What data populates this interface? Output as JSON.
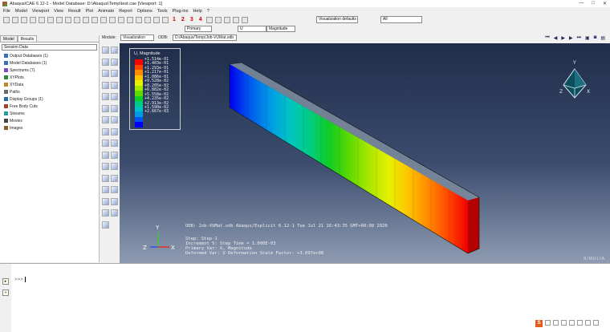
{
  "window": {
    "title": "Abaqus/CAE 6.12-1 - Model Database: D:\\Abaqus\\Temp\\test.cae [Viewport: 1]",
    "controls": [
      "—",
      "□",
      "✕"
    ]
  },
  "menu": [
    "File",
    "Model",
    "Viewport",
    "View",
    "Result",
    "Plot",
    "Animate",
    "Report",
    "Options",
    "Tools",
    "Plug-ins",
    "Help",
    "?"
  ],
  "toolbar": {
    "numbers": [
      "1",
      "2",
      "3",
      "4"
    ],
    "visualization_select": "Visualization defaults",
    "search_value": "All"
  },
  "toolbar2": {
    "step_select": "Primary",
    "u_select": "U",
    "magnitude_select": "Magnitude"
  },
  "module_row": {
    "module_label": "Module:",
    "module_value": "Visualization",
    "odb_label": "ODB:",
    "odb_value": "D:/Abaqus/Temp/Job-VUMat.odb"
  },
  "left_panel": {
    "tabs": [
      "Model",
      "Results"
    ],
    "active_tab": "Results",
    "session_box": "Session Data",
    "tree": [
      {
        "label": "Output Databases (1)",
        "icon": "database-icon"
      },
      {
        "label": "Model Databases (1)",
        "icon": "database-icon"
      },
      {
        "label": "Spectrums (7)",
        "icon": "spectrum-icon"
      },
      {
        "label": "XYPlots",
        "icon": "xyplot-icon"
      },
      {
        "label": "XYData",
        "icon": "xydata-icon"
      },
      {
        "label": "Paths",
        "icon": "path-icon"
      },
      {
        "label": "Display Groups (1)",
        "icon": "display-group-icon"
      },
      {
        "label": "Free Body Cuts",
        "icon": "freebody-icon"
      },
      {
        "label": "Streams",
        "icon": "stream-icon"
      },
      {
        "label": "Movies",
        "icon": "movie-icon"
      },
      {
        "label": "Images",
        "icon": "image-icon"
      }
    ]
  },
  "legend": {
    "title": "U, Magnitude",
    "values": [
      "+1.514e-01",
      "+1.403e-01",
      "+1.293e-01",
      "+1.217e-01",
      "+1.086e-01",
      "+9.528e-02",
      "+8.205e-02",
      "+6.882e-02",
      "+5.558e-02",
      "+4.235e-02",
      "+2.913e-02",
      "+1.590e-02",
      "+2.667e-03"
    ],
    "colors": [
      "#ff0000",
      "#ff4500",
      "#ff8c00",
      "#ffc400",
      "#e6f000",
      "#a6e600",
      "#5bd900",
      "#11cc22",
      "#00cc88",
      "#00c4c4",
      "#0099e6",
      "#0055ee",
      "#0000ff"
    ]
  },
  "info": {
    "odb_line": "ODB: Job-VUMat.odb    Abaqus/Explicit 6.12-1    Tue Jul 21 16:43:35 GMT+08:00 2020",
    "step_line": "Step: Step-1",
    "increment_line": "Increment      5: Step Time =    1.000E-03",
    "primary_line": "Primary Var: U, Magnitude",
    "deformed_line": "Deformed Var: U   Deformation Scale Factor: +3.097e+00"
  },
  "axes": {
    "x": "X",
    "y": "Y",
    "z": "Z"
  },
  "branding": "SIMULIA",
  "message": {
    "prompt": ">>>"
  },
  "tray": {
    "s_label": "S"
  }
}
